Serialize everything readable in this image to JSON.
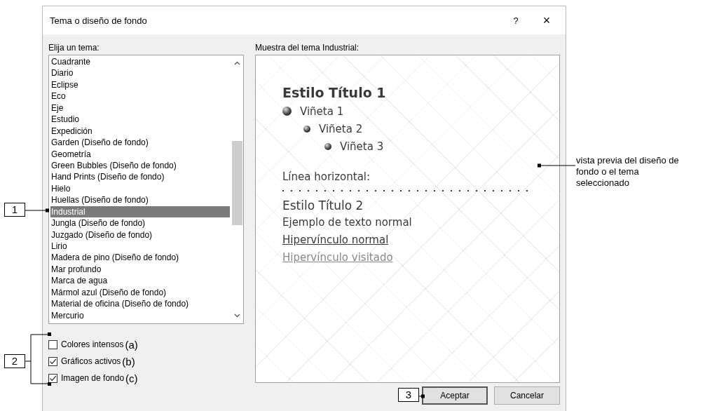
{
  "window": {
    "title": "Tema o diseño de fondo",
    "help_button": "?",
    "close_button": "×"
  },
  "theme_list": {
    "label": "Elija un tema:",
    "items": [
      {
        "label": "Cuadrante",
        "selected": false
      },
      {
        "label": "Diario",
        "selected": false
      },
      {
        "label": "Eclipse",
        "selected": false
      },
      {
        "label": "Eco",
        "selected": false
      },
      {
        "label": "Eje",
        "selected": false
      },
      {
        "label": "Estudio",
        "selected": false
      },
      {
        "label": "Expedición",
        "selected": false
      },
      {
        "label": "Garden (Diseño de fondo)",
        "selected": false
      },
      {
        "label": "Geometría",
        "selected": false
      },
      {
        "label": "Green Bubbles (Diseño de fondo)",
        "selected": false
      },
      {
        "label": "Hand Prints (Diseño de fondo)",
        "selected": false
      },
      {
        "label": "Hielo",
        "selected": false
      },
      {
        "label": "Huellas (Diseño de fondo)",
        "selected": false
      },
      {
        "label": "Industrial",
        "selected": true
      },
      {
        "label": "Jungla (Diseño de fondo)",
        "selected": false
      },
      {
        "label": "Juzgado (Diseño de fondo)",
        "selected": false
      },
      {
        "label": "Lirio",
        "selected": false
      },
      {
        "label": "Madera de pino (Diseño de fondo)",
        "selected": false
      },
      {
        "label": "Mar profundo",
        "selected": false
      },
      {
        "label": "Marca de agua",
        "selected": false
      },
      {
        "label": "Mármol azul (Diseño de fondo)",
        "selected": false
      },
      {
        "label": "Material de oficina (Diseño de fondo)",
        "selected": false
      },
      {
        "label": "Mercurio",
        "selected": false
      }
    ]
  },
  "options": [
    {
      "label": "Colores intensos",
      "tag": "(a)",
      "checked": false
    },
    {
      "label": "Gráficos activos",
      "tag": "(b)",
      "checked": true
    },
    {
      "label": "Imagen de fondo",
      "tag": "(c)",
      "checked": true
    }
  ],
  "preview": {
    "label": "Muestra del tema Industrial:",
    "items": [
      {
        "kind": "heading1",
        "text": "Estilo Título 1"
      },
      {
        "kind": "bullet",
        "text": "Viñeta 1",
        "children": [
          {
            "kind": "bullet",
            "text": "Viñeta 2",
            "children": [
              {
                "kind": "bullet",
                "text": "Viñeta 3"
              }
            ]
          }
        ]
      },
      {
        "kind": "label",
        "text": "Línea horizontal:"
      },
      {
        "kind": "rule"
      },
      {
        "kind": "heading2",
        "text": "Estilo Título 2"
      },
      {
        "kind": "text",
        "text": "Ejemplo de texto normal"
      },
      {
        "kind": "link",
        "text": "Hipervínculo normal"
      },
      {
        "kind": "visited_link",
        "text": "Hipervínculo visitado"
      }
    ]
  },
  "buttons": [
    "Aceptar",
    "Cancelar"
  ],
  "callouts": [
    {
      "label": "1"
    },
    {
      "label": "2"
    },
    {
      "label": "3"
    }
  ],
  "side_note": "vista previa del diseño de fondo o el tema seleccionado"
}
